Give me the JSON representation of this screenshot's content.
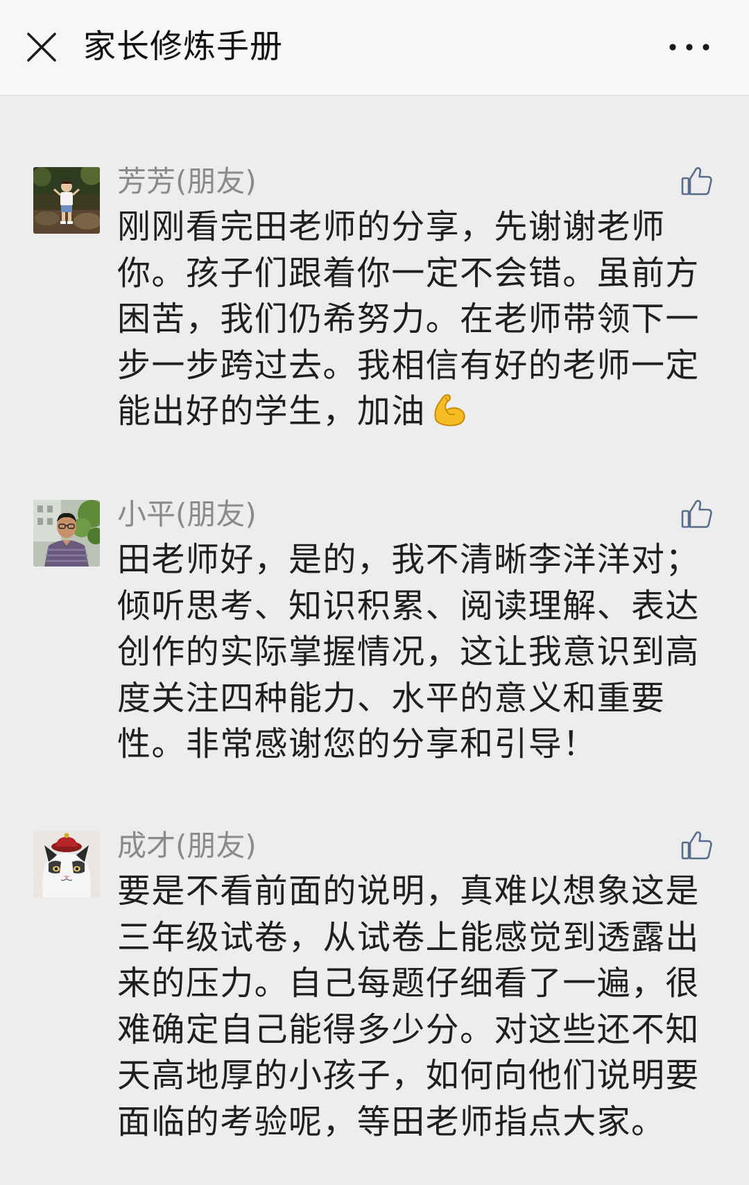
{
  "header": {
    "close_icon": "close-icon",
    "title": "家长修炼手册",
    "more_icon": "more-dots-icon"
  },
  "colors": {
    "background": "#ededed",
    "header_background": "#f7f7f7",
    "name_text": "#8a8a8a",
    "body_text": "#1f1f1f",
    "like_icon": "#5b6b8c"
  },
  "comments": [
    {
      "name": "芳芳(朋友)",
      "avatar": "avatar-child-photo",
      "like_icon": "thumbs-up-icon",
      "lines": [
        "刚刚看完田老师的分享，先谢谢老师",
        "你。孩子们跟着你一定不会错。虽前方",
        "困苦，我们仍希努力。在老师带领下一",
        "步一步跨过去。我相信有好的老师一定",
        "能出好的学生，加油"
      ],
      "trailing_emoji": "flexed-biceps-icon"
    },
    {
      "name": "小平(朋友)",
      "avatar": "avatar-man-photo",
      "like_icon": "thumbs-up-icon",
      "lines": [
        "田老师好，是的，我不清晰李洋洋对；",
        "倾听思考、知识积累、阅读理解、表达",
        "创作的实际掌握情况，这让我意识到高",
        "度关注四种能力、水平的意义和重要",
        "性。非常感谢您的分享和引导！"
      ]
    },
    {
      "name": "成才(朋友)",
      "avatar": "avatar-cat-with-hat",
      "like_icon": "thumbs-up-icon",
      "lines": [
        "要是不看前面的说明，真难以想象这是",
        "三年级试卷，从试卷上能感觉到透露出",
        "来的压力。自己每题仔细看了一遍，很",
        "难确定自己能得多少分。对这些还不知",
        "天高地厚的小孩子，如何向他们说明要",
        "面临的考验呢，等田老师指点大家。"
      ]
    }
  ]
}
